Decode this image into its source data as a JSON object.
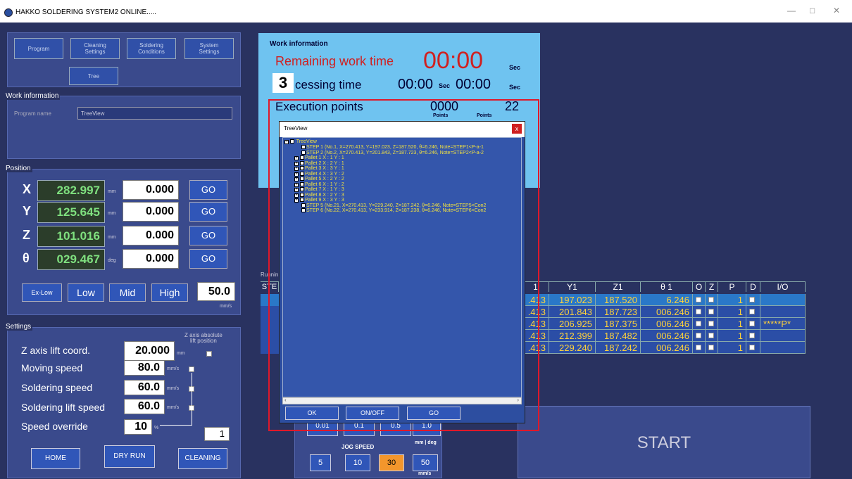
{
  "window": {
    "title": "HAKKO SOLDERING SYSTEM2 ONLINE.....",
    "min": "—",
    "max": "□",
    "close": "✕"
  },
  "topmenu": {
    "program": "Program",
    "cleaning": "Cleaning\nSettings",
    "soldering": "Soldering\nConditions",
    "system": "System\nSettings",
    "tree": "Tree"
  },
  "workinfo_left": {
    "label": "Work information",
    "program_name_label": "Program name",
    "program_name": "TreeView"
  },
  "position": {
    "label": "Position",
    "axes": [
      {
        "name": "X",
        "value": "282.997",
        "unit": "mm",
        "input": "0.000",
        "go": "GO"
      },
      {
        "name": "Y",
        "value": "125.645",
        "unit": "mm",
        "input": "0.000",
        "go": "GO"
      },
      {
        "name": "Z",
        "value": "101.016",
        "unit": "mm",
        "input": "0.000",
        "go": "GO"
      },
      {
        "name": "θ",
        "value": "029.467",
        "unit": "deg",
        "input": "0.000",
        "go": "GO"
      }
    ],
    "speeds": [
      "Ex-Low",
      "Low",
      "Mid",
      "High"
    ],
    "speed_value": "50.0",
    "speed_unit": "mm/s"
  },
  "settings": {
    "label": "Settings",
    "z_abs_label": "Z axis absolute\nlift position",
    "rows": [
      {
        "label": "Z axis lift coord.",
        "value": "20.000",
        "unit": "mm"
      },
      {
        "label": "Moving speed",
        "value": "80.0",
        "unit": "mm/s"
      },
      {
        "label": "Soldering speed",
        "value": "60.0",
        "unit": "mm/s"
      },
      {
        "label": "Soldering lift speed",
        "value": "60.0",
        "unit": "mm/s"
      },
      {
        "label": "Speed override",
        "value": "10",
        "unit": "%"
      }
    ],
    "override_box": "1",
    "home": "HOME",
    "dryrun": "DRY RUN",
    "cleaning": "CLEANING"
  },
  "workinfo": {
    "title": "Work information",
    "remaining_label": "Remaining work time",
    "remaining": "00:00",
    "sec": "Sec",
    "badge": "3",
    "processing_label": "cessing time",
    "proc1": "00:00",
    "proc2": "00:00",
    "exec_label": "Execution points",
    "exec1": "0000",
    "exec2": "22",
    "points": "Points"
  },
  "table": {
    "running_label": "Runnin",
    "header_left": "STE",
    "headers": [
      "1",
      "Y1",
      "Z1",
      "θ 1",
      "O",
      "Z",
      "P",
      "D",
      "I/O"
    ],
    "rows": [
      {
        "x": ".413",
        "y": "197.023",
        "z": "187.520",
        "t": "6.246",
        "p": "1",
        "io": ""
      },
      {
        "x": ".413",
        "y": "201.843",
        "z": "187.723",
        "t": "006.246",
        "p": "1",
        "io": ""
      },
      {
        "x": ".413",
        "y": "206.925",
        "z": "187.375",
        "t": "006.246",
        "p": "1",
        "io": "*****P*"
      },
      {
        "x": ".413",
        "y": "212.399",
        "z": "187.482",
        "t": "006.246",
        "p": "1",
        "io": ""
      },
      {
        "x": ".413",
        "y": "229.240",
        "z": "187.242",
        "t": "006.246",
        "p": "1",
        "io": ""
      }
    ]
  },
  "jog": {
    "label": "JOG SPEED",
    "unit_mm": "mm | deg",
    "buttons": [
      "5",
      "10",
      "30",
      "50"
    ],
    "unit": "mm/s",
    "top": [
      "0.01",
      "0.1",
      "0.5",
      "1.0"
    ]
  },
  "start": "START",
  "treeview": {
    "title": "TreeView",
    "close": "x",
    "root": "TreeView",
    "nodes": [
      "STEP 1 (No.1, X=270.413, Y=197.023, Z=187.520, θ=6.246, Note=STEP1<P-a-1",
      "STEP 2 (No.2, X=270.413, Y=201.843, Z=187.723, θ=6.246, Note=STEP2<P-a-2",
      "Pallet 1 X : 1 Y : 1",
      "Pallet 2 X : 2 Y : 1",
      "Pallet 3 X : 3 Y : 1",
      "Pallet 4 X : 3 Y : 2",
      "Pallet 5 X : 2 Y : 2",
      "Pallet 6 X : 1 Y : 2",
      "Pallet 7 X : 1 Y : 3",
      "Pallet 8 X : 2 Y : 3",
      "Pallet 9 X : 3 Y : 3",
      "STEP 5 (No.21, X=270.413, Y=229.240, Z=187.242, θ=6.246, Note=STEP5<Con2",
      "STEP 6 (No.22, X=270.413, Y=233.914, Z=187.238, θ=6.246, Note=STEP6<Con2"
    ],
    "ok": "OK",
    "onoff": "ON/OFF",
    "go": "GO"
  }
}
